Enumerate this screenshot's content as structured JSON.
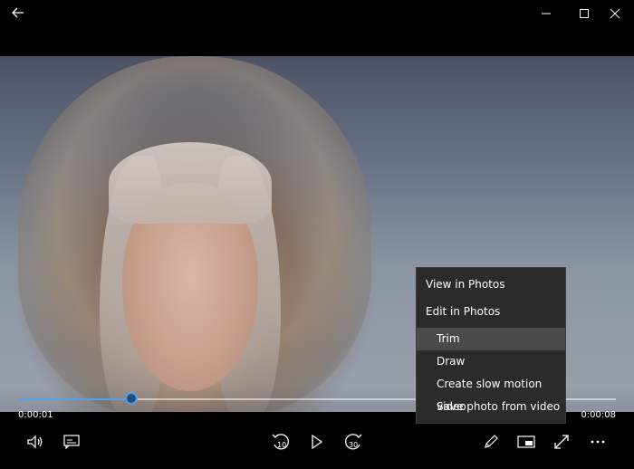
{
  "player": {
    "current_time": "0:00:01",
    "duration": "0:00:08",
    "progress": 0.19,
    "accent_color": "#5aa0e6"
  },
  "titlebar": {
    "icons": [
      "back-arrow-icon",
      "minimize-icon",
      "maximize-icon",
      "close-icon"
    ]
  },
  "context_menu": {
    "items": [
      "View in Photos",
      "Edit in Photos",
      "Trim",
      "Draw",
      "Create slow motion video",
      "Save photo from video"
    ],
    "highlighted": "Trim"
  },
  "controls": {
    "icons": [
      "volume-icon",
      "subtitles-icon",
      "skip-back-10-icon",
      "play-icon",
      "skip-forward-30-icon",
      "pencil-icon",
      "mini-view-icon",
      "fullscreen-icon",
      "more-icon"
    ],
    "skip_back_label": "10",
    "skip_forward_label": "30"
  }
}
